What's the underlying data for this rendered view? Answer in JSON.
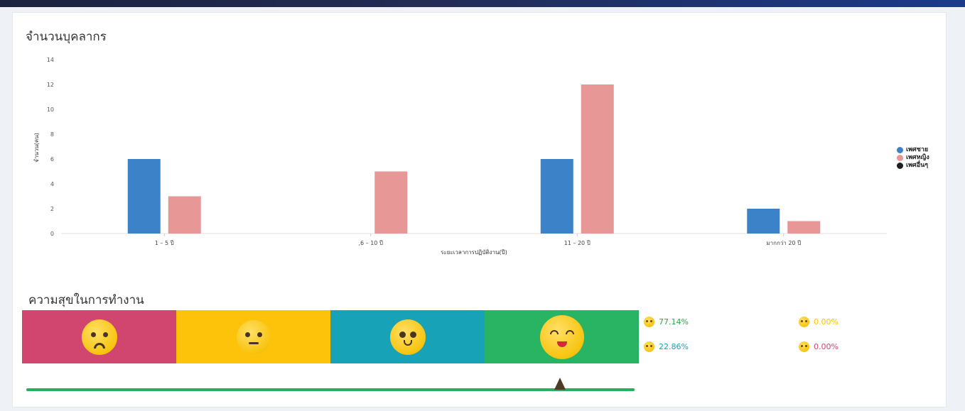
{
  "staff_title": "จำนวนบุคลากร",
  "happiness_title": "ความสุขในการทำงาน",
  "chart_data": {
    "type": "bar",
    "categories": [
      "1 – 5 ปี",
      ",6 – 10 ปี",
      "11 – 20 ปี",
      "มากกว่า 20 ปี"
    ],
    "series": [
      {
        "name": "เพศชาย",
        "color": "#3c82c8",
        "values": [
          6,
          0,
          6,
          2
        ]
      },
      {
        "name": "เพศหญิง",
        "color": "#e89797",
        "values": [
          3,
          5,
          12,
          1
        ]
      },
      {
        "name": "เพศอื่นๆ",
        "color": "#1e1e1e",
        "values": [
          0,
          0,
          0,
          0
        ]
      }
    ],
    "xlabel": "ระยะเวลาการปฏิบัติงาน(ปี)",
    "ylabel": "จำนวน(คน)",
    "ylim": [
      0,
      14
    ],
    "yticks": [
      "0",
      "2",
      "4",
      "6",
      "8",
      "10",
      "12",
      "14"
    ],
    "legend_position": "right",
    "grid": false
  },
  "mood_segments": [
    {
      "mood": "sad",
      "color": "#d0466e"
    },
    {
      "mood": "neutral",
      "color": "#fdc20a"
    },
    {
      "mood": "smile",
      "color": "#17a2b8"
    },
    {
      "mood": "happy",
      "color": "#28b463"
    }
  ],
  "mood_stats": [
    {
      "mood": "happy",
      "value": "77.14%",
      "color": "#28a745"
    },
    {
      "mood": "neutral",
      "value": "0.00%",
      "color": "#fdc20a"
    },
    {
      "mood": "smile",
      "value": "22.86%",
      "color": "#17a2b8"
    },
    {
      "mood": "sad",
      "value": "0.00%",
      "color": "#d0466e"
    }
  ],
  "happiness_indicator": 0.877
}
